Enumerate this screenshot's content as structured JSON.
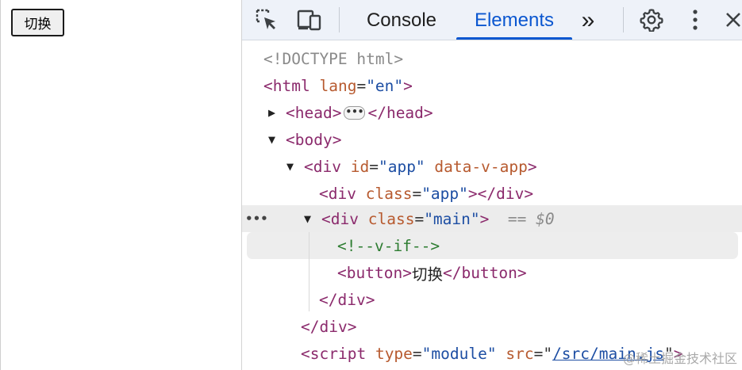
{
  "page": {
    "button_label": "切换"
  },
  "toolbar": {
    "tabs": [
      {
        "label": "Console",
        "active": false
      },
      {
        "label": "Elements",
        "active": true
      }
    ],
    "icons": [
      "inspect-element-icon",
      "device-toolbar-icon",
      "more-tabs-icon",
      "settings-icon",
      "more-options-icon",
      "close-icon"
    ],
    "more_tabs_glyph": "»",
    "accent_color": "#0b57d0"
  },
  "tree": {
    "doctype": "<!DOCTYPE html>",
    "html_tag": "html",
    "html_attr": "lang",
    "html_val": "\"en\"",
    "head_tag": "head",
    "body_tag": "body",
    "div_app_id_attr": "id",
    "div_app_id_val": "\"app\"",
    "div_app_data_attr": "data-v-app",
    "div_tag": "div",
    "class_attr": "class",
    "app_class_val": "\"app\"",
    "main_class_val": "\"main\"",
    "selected_marker": "== $0",
    "comment": "<!--v-if-->",
    "button_tag": "button",
    "button_text": "切换",
    "script_tag": "script",
    "type_attr": "type",
    "type_val": "\"module\"",
    "src_attr": "src",
    "src_val": "/src/main.js",
    "row_dots": "•••"
  },
  "watermark": "@稀土掘金技术社区"
}
